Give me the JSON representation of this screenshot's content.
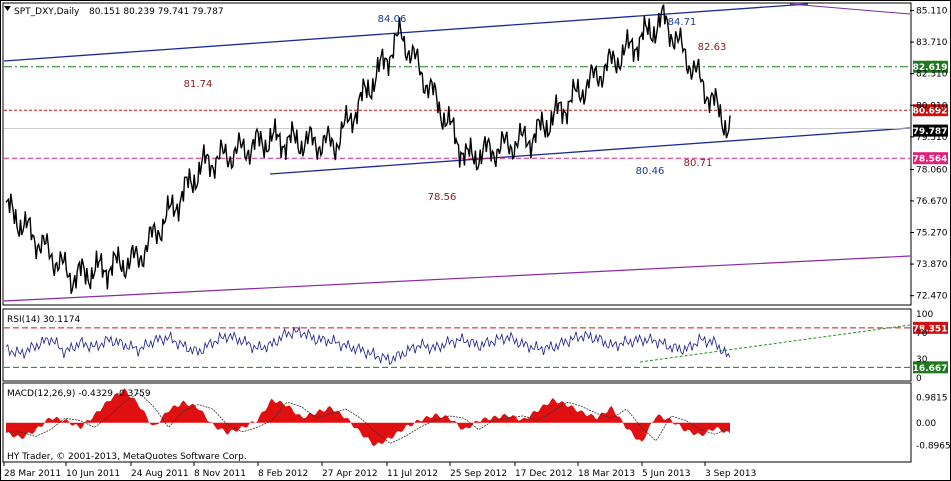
{
  "chart_data": {
    "type": "line",
    "symbol": "SPT_DXY,Daily",
    "ohlc": "80.151 80.239 79.741 79.787",
    "price_axis": [
      "85.110",
      "83.710",
      "82.310",
      "80.910",
      "79.510",
      "78.060",
      "76.670",
      "75.270",
      "73.870",
      "72.470"
    ],
    "price_ylim": [
      72.1,
      85.4
    ],
    "x_labels": [
      "28 Mar 2011",
      "10 Jun 2011",
      "24 Aug 2011",
      "8 Nov 2011",
      "8 Feb 2012",
      "27 Apr 2012",
      "11 Jul 2012",
      "25 Sep 2012",
      "17 Dec 2012",
      "18 Mar 2013",
      "5 Jun 2013",
      "3 Sep 2013"
    ],
    "series": [
      {
        "x": [
          "28 Mar 2011",
          "10 Jun 2011",
          "24 Aug 2011",
          "8 Nov 2011",
          "8 Feb 2012",
          "27 Apr 2012",
          "11 Jul 2012",
          "25 Sep 2012",
          "17 Dec 2012",
          "18 Mar 2013",
          "5 Jun 2013",
          "3 Sep 2013"
        ],
        "values": [
          76.4,
          73.3,
          74.1,
          78.3,
          79.4,
          79.2,
          84.06,
          78.56,
          79.5,
          82.3,
          84.71,
          79.787
        ]
      }
    ],
    "annotations": [
      {
        "text": "84.06",
        "color": "#1a3a9c"
      },
      {
        "text": "84.71",
        "color": "#1a3a9c"
      },
      {
        "text": "81.74",
        "color": "#8b1a1a"
      },
      {
        "text": "82.63",
        "color": "#8b1a1a"
      },
      {
        "text": "80.46",
        "color": "#1a3a9c"
      },
      {
        "text": "80.71",
        "color": "#8b1a1a"
      },
      {
        "text": "78.56",
        "color": "#8b1a1a"
      }
    ],
    "levels": [
      {
        "value": 82.619,
        "label": "82.619",
        "color": "#1e7a1e"
      },
      {
        "value": 80.692,
        "label": "80.692",
        "color": "#d01010"
      },
      {
        "value": 79.787,
        "label": "79.787",
        "color": "#000000"
      },
      {
        "value": 78.564,
        "label": "78.564",
        "color": "#e0207a"
      }
    ],
    "rsi": {
      "title": "RSI(14) 30.1174",
      "axis": [
        "100",
        "70",
        "30",
        "0"
      ],
      "ylim": [
        0,
        100
      ],
      "levels": [
        {
          "value": 78.351,
          "label": "78.351",
          "color": "#d01010"
        },
        {
          "value": 16.667,
          "label": "16.667",
          "color": "#1e7a1e"
        }
      ],
      "values": [
        45,
        38,
        50,
        62,
        40,
        55,
        48,
        60,
        52,
        44,
        58,
        63,
        50,
        40,
        56,
        66,
        58,
        46,
        52,
        70,
        72,
        60,
        58,
        50,
        44,
        35,
        28,
        40,
        52,
        46,
        56,
        60,
        50,
        58,
        64,
        52,
        46,
        48,
        58,
        66,
        62,
        50,
        56,
        60,
        58,
        48,
        44,
        60,
        55,
        30
      ]
    },
    "macd": {
      "title": "MACD(12,26,9) -0.4329 -0.3759",
      "axis": [
        "0.9815",
        "0.00",
        "-0.8965"
      ],
      "ylim": [
        -1.3,
        1.4
      ],
      "values": [
        -0.4,
        -0.6,
        -0.3,
        0.2,
        0.1,
        -0.2,
        0.3,
        0.9,
        1.3,
        0.7,
        -0.2,
        0.5,
        0.8,
        0.6,
        -0.1,
        -0.4,
        -0.2,
        0.1,
        0.9,
        0.7,
        0.2,
        0.4,
        0.6,
        0.2,
        -0.4,
        -0.9,
        -0.6,
        -0.2,
        0.1,
        0.3,
        0.2,
        -0.3,
        0.1,
        0.2,
        0.3,
        0.1,
        0.5,
        0.9,
        0.7,
        0.4,
        0.2,
        0.6,
        -0.2,
        -0.8,
        0.3,
        0.1,
        -0.3,
        -0.5,
        -0.2,
        -0.43
      ]
    },
    "copyright": "HY Trader, © 2001-2013, MetaQuotes Software Corp."
  }
}
